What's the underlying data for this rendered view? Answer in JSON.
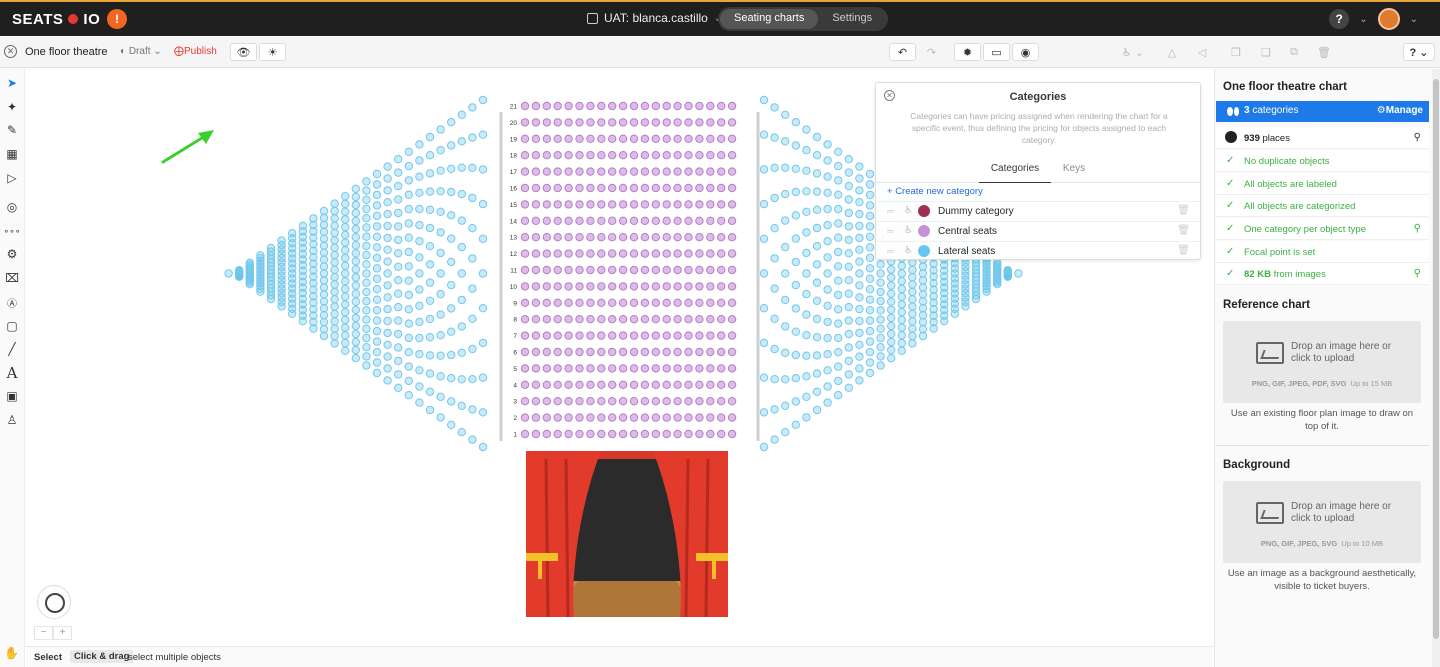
{
  "topbar": {
    "logo_left": "SEATS",
    "logo_right": "IO",
    "workspace": "UAT: blanca.castillo",
    "tabs": [
      {
        "label": "Seating charts",
        "active": true
      },
      {
        "label": "Settings",
        "active": false
      }
    ],
    "help": "?"
  },
  "toolbar": {
    "chart_name": "One floor theatre",
    "status": "Draft",
    "publish": "Publish"
  },
  "colors": {
    "dummy": "#9b2c4e",
    "central": "#c78fd8",
    "lateral": "#63c7ef",
    "accent": "#1e7ae8",
    "success": "#3cb043",
    "publish": "#e53935"
  },
  "seatmap": {
    "row_labels": [
      "21",
      "20",
      "19",
      "18",
      "17",
      "16",
      "15",
      "14",
      "13",
      "12",
      "11",
      "10",
      "9",
      "8",
      "7",
      "6",
      "5",
      "4",
      "3",
      "2",
      "1"
    ]
  },
  "categories_popup": {
    "title": "Categories",
    "description": "Categories can have pricing assigned when rendering the chart for a specific event, thus defining the pricing for objects assigned to each category.",
    "tabs": [
      {
        "label": "Categories",
        "active": true
      },
      {
        "label": "Keys",
        "active": false
      }
    ],
    "create_label": "Create new category",
    "items": [
      {
        "name": "Dummy category",
        "color": "#9b2c4e"
      },
      {
        "name": "Central seats",
        "color": "#c78fd8"
      },
      {
        "name": "Lateral seats",
        "color": "#63c7ef"
      }
    ]
  },
  "right_panel": {
    "title": "One floor theatre chart",
    "categories_count": "3",
    "categories_label": "categories",
    "manage": "Manage",
    "places_count": "939",
    "places_label": "places",
    "checks": [
      {
        "text": "No duplicate objects",
        "search": false
      },
      {
        "text": "All objects are labeled",
        "search": false
      },
      {
        "text": "All objects are categorized",
        "search": false
      },
      {
        "text": "One category per object type",
        "search": true
      },
      {
        "text": "Focal point is set",
        "search": false
      },
      {
        "text_bold": "82 KB",
        "text": "from images",
        "search": true
      }
    ],
    "reference": {
      "title": "Reference chart",
      "drop": "Drop an image here or click to upload",
      "formats": "PNG, GIF, JPEG, PDF, SVG",
      "limit": "Up to 15 MB",
      "note": "Use an existing floor plan image to draw on top of it."
    },
    "background": {
      "title": "Background",
      "drop": "Drop an image here or click to upload",
      "formats": "PNG, GIF, JPEG, SVG",
      "limit": "Up to 10 MB",
      "note": "Use an image as a background aesthetically, visible to ticket buyers."
    }
  },
  "statusbar": {
    "mode": "Select",
    "key": "Click & drag",
    "hint": "select multiple objects"
  },
  "icons": {
    "lefttools": [
      "select-icon",
      "node-icon",
      "brush-icon",
      "seat-grid-icon",
      "cursor-icon",
      "focal-icon",
      "rows-icon",
      "table-icon",
      "booth-icon",
      "label-icon",
      "shape-icon",
      "line-icon",
      "text-icon",
      "image-icon",
      "people-icon"
    ]
  }
}
